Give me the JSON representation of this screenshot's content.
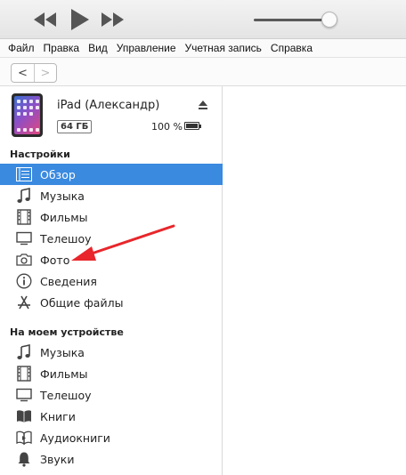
{
  "player": {
    "volume_level": 0.82
  },
  "menu": [
    "Файл",
    "Правка",
    "Вид",
    "Управление",
    "Учетная запись",
    "Справка"
  ],
  "nav": {
    "back": "<",
    "forward": ">"
  },
  "device": {
    "name": "iPad (Александр)",
    "capacity": "64 ГБ",
    "battery": "100 %"
  },
  "sections": {
    "settings": {
      "title": "Настройки",
      "items": [
        {
          "label": "Обзор",
          "icon": "summary-icon",
          "active": true
        },
        {
          "label": "Музыка",
          "icon": "music-note-icon"
        },
        {
          "label": "Фильмы",
          "icon": "film-icon"
        },
        {
          "label": "Телешоу",
          "icon": "tv-icon"
        },
        {
          "label": "Фото",
          "icon": "camera-icon"
        },
        {
          "label": "Сведения",
          "icon": "info-icon"
        },
        {
          "label": "Общие файлы",
          "icon": "app-store-icon"
        }
      ]
    },
    "on_device": {
      "title": "На моем устройстве",
      "items": [
        {
          "label": "Музыка",
          "icon": "music-note-icon"
        },
        {
          "label": "Фильмы",
          "icon": "film-icon"
        },
        {
          "label": "Телешоу",
          "icon": "tv-icon"
        },
        {
          "label": "Книги",
          "icon": "book-icon"
        },
        {
          "label": "Аудиокниги",
          "icon": "audiobook-icon"
        },
        {
          "label": "Звуки",
          "icon": "bell-icon"
        }
      ]
    }
  },
  "colors": {
    "selection": "#3a8ae0",
    "annotation_arrow": "#e8262b"
  }
}
